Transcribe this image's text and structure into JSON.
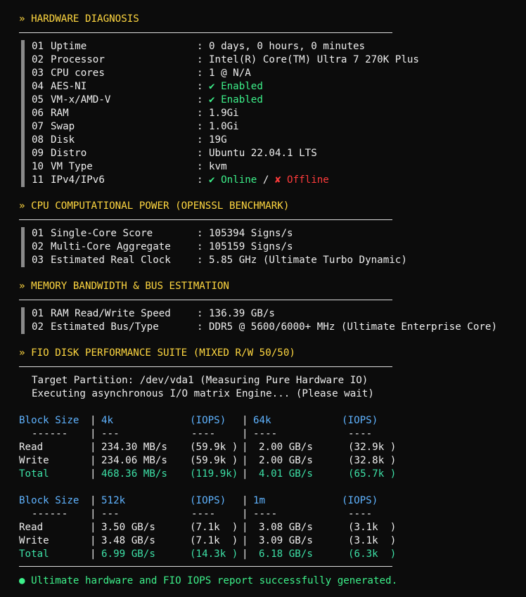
{
  "sections": {
    "hardware": {
      "title": "» HARDWARE DIAGNOSIS",
      "rows": [
        {
          "n": "01",
          "label": "Uptime",
          "value": "0 days, 0 hours, 0 minutes"
        },
        {
          "n": "02",
          "label": "Processor",
          "value": "Intel(R) Core(TM) Ultra 7 270K Plus"
        },
        {
          "n": "03",
          "label": "CPU cores",
          "value": "1 @ N/A"
        },
        {
          "n": "04",
          "label": "AES-NI",
          "value": "✔ Enabled"
        },
        {
          "n": "05",
          "label": "VM-x/AMD-V",
          "value": "✔ Enabled"
        },
        {
          "n": "06",
          "label": "RAM",
          "value": "1.9Gi"
        },
        {
          "n": "07",
          "label": "Swap",
          "value": "1.0Gi"
        },
        {
          "n": "08",
          "label": "Disk",
          "value": "19G"
        },
        {
          "n": "09",
          "label": "Distro",
          "value": "Ubuntu 22.04.1 LTS"
        },
        {
          "n": "10",
          "label": "VM Type",
          "value": "kvm"
        },
        {
          "n": "11",
          "label": "IPv4/IPv6",
          "online": "✔ Online",
          "sep": " / ",
          "offline": "✘ Offline"
        }
      ]
    },
    "cpu": {
      "title": "» CPU COMPUTATIONAL POWER (OPENSSL BENCHMARK)",
      "rows": [
        {
          "n": "01",
          "label": "Single-Core Score",
          "value": "105394 Signs/s"
        },
        {
          "n": "02",
          "label": "Multi-Core Aggregate",
          "value": "105159 Signs/s"
        },
        {
          "n": "03",
          "label": "Estimated Real Clock",
          "value": "5.85 GHz (Ultimate Turbo Dynamic)"
        }
      ]
    },
    "memory": {
      "title": "» MEMORY BANDWIDTH & BUS ESTIMATION",
      "rows": [
        {
          "n": "01",
          "label": "RAM Read/Write Speed",
          "value": "136.39 GB/s"
        },
        {
          "n": "02",
          "label": "Estimated Bus/Type",
          "value": "DDR5 @ 5600/6000+ MHz (Ultimate Enterprise Core)"
        }
      ]
    },
    "fio": {
      "title": "» FIO DISK PERFORMANCE SUITE (MIXED R/W 50/50)",
      "target": "Target Partition: /dev/vda1 (Measuring Pure Hardware IO)",
      "executing": "Executing asynchronous I/O matrix Engine... (Please wait)",
      "tables": [
        {
          "header": [
            "Block Size",
            "4k",
            "(IOPS)",
            "64k",
            "(IOPS)"
          ],
          "dashes": [
            "------",
            "---",
            "----",
            "----",
            "----"
          ],
          "rows": [
            {
              "name": "Read",
              "a": "234.30 MB/s",
              "ai": "(59.9k )",
              "b": "2.00 GB/s",
              "bi": "(32.9k )"
            },
            {
              "name": "Write",
              "a": "234.06 MB/s",
              "ai": "(59.9k )",
              "b": "2.00 GB/s",
              "bi": "(32.8k )"
            },
            {
              "name": "Total",
              "a": "468.36 MB/s",
              "ai": "(119.9k)",
              "b": "4.01 GB/s",
              "bi": "(65.7k )"
            }
          ]
        },
        {
          "header": [
            "Block Size",
            "512k",
            "(IOPS)",
            "1m",
            "(IOPS)"
          ],
          "dashes": [
            "------",
            "---",
            "----",
            "----",
            "----"
          ],
          "rows": [
            {
              "name": "Read",
              "a": "3.50 GB/s",
              "ai": "(7.1k  )",
              "b": "3.08 GB/s",
              "bi": "(3.1k  )"
            },
            {
              "name": "Write",
              "a": "3.48 GB/s",
              "ai": "(7.1k  )",
              "b": "3.09 GB/s",
              "bi": "(3.1k  )"
            },
            {
              "name": "Total",
              "a": "6.99 GB/s",
              "ai": "(14.3k )",
              "b": "6.18 GB/s",
              "bi": "(6.3k  )"
            }
          ]
        }
      ]
    }
  },
  "footer": "● Ultimate hardware and FIO IOPS report successfully generated.",
  "colors": {
    "header": "#ffd740",
    "green": "#3df08a",
    "blue": "#5fb3ff",
    "red": "#ff3b3b",
    "background": "#0c0c0c"
  }
}
